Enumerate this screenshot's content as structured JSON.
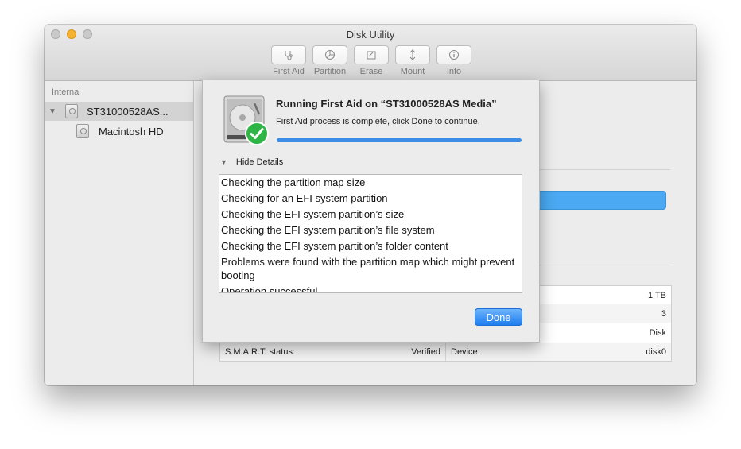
{
  "window": {
    "title": "Disk Utility"
  },
  "toolbar": {
    "items": [
      {
        "label": "First Aid",
        "icon": "stethoscope-icon"
      },
      {
        "label": "Partition",
        "icon": "pie-chart-icon"
      },
      {
        "label": "Erase",
        "icon": "erase-icon"
      },
      {
        "label": "Mount",
        "icon": "mount-icon"
      },
      {
        "label": "Info",
        "icon": "info-icon"
      }
    ]
  },
  "sidebar": {
    "header": "Internal",
    "items": [
      {
        "label": "ST31000528AS...",
        "selected": true,
        "expanded": true
      },
      {
        "label": "Macintosh HD",
        "selected": false
      }
    ]
  },
  "info_table": {
    "rows": [
      {
        "left_label": "",
        "left_value": "",
        "right_label": "",
        "right_value": "1 TB"
      },
      {
        "left_label": "",
        "left_value": "",
        "right_label": "",
        "right_value": "3"
      },
      {
        "left_label": "",
        "left_value": "",
        "right_label": "",
        "right_value": "Disk"
      },
      {
        "left_label": "S.M.A.R.T. status:",
        "left_value": "Verified",
        "right_label": "Device:",
        "right_value": "disk0"
      }
    ]
  },
  "sheet": {
    "title": "Running First Aid on “ST31000528AS Media”",
    "message": "First Aid process is complete, click Done to continue.",
    "progress": 1.0,
    "details_toggle": "Hide Details",
    "log_lines": [
      "Checking the partition map size",
      "Checking for an EFI system partition",
      "Checking the EFI system partition’s size",
      "Checking the EFI system partition’s file system",
      "Checking the EFI system partition’s folder content",
      "Problems were found with the partition map which might prevent booting",
      "Operation successful."
    ],
    "done_label": "Done"
  },
  "colors": {
    "accent": "#3b8de8",
    "selection_bar": "#4aa9f2",
    "checkmark_badge": "#2fb545",
    "minimize_button": "#f5b332"
  }
}
